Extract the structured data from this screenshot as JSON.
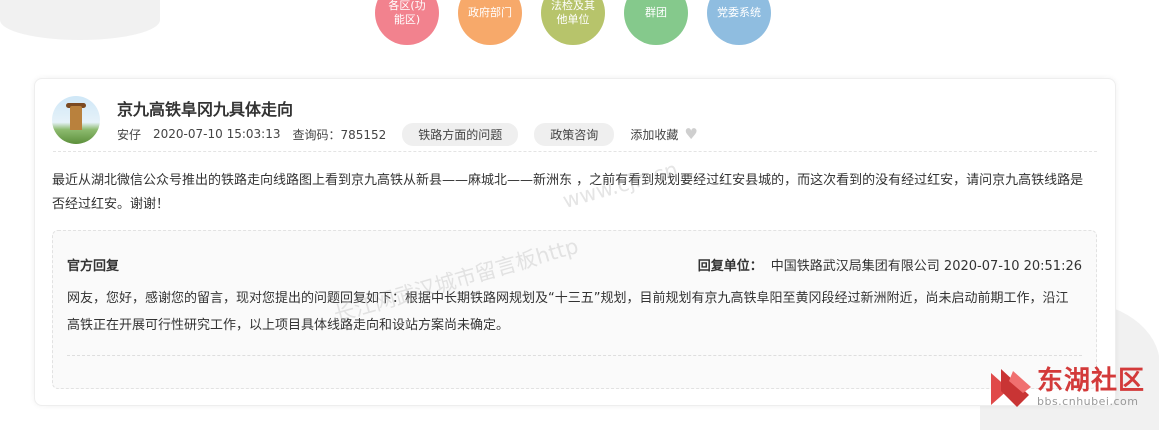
{
  "categories": [
    {
      "label": "各区(功能区)",
      "color": "#f2828e"
    },
    {
      "label": "政府部门",
      "color": "#f7a96a"
    },
    {
      "label": "法检及其他单位",
      "color": "#b7c46b"
    },
    {
      "label": "群团",
      "color": "#85c98c"
    },
    {
      "label": "党委系统",
      "color": "#8fbde0"
    }
  ],
  "post": {
    "title": "京九高铁阜冈九具体走向",
    "author": "安仔",
    "datetime": "2020-07-10 15:03:13",
    "query_code": "查询码：785152",
    "tags": [
      "铁路方面的问题",
      "政策咨询"
    ],
    "favorite_label": "添加收藏",
    "content": "最近从湖北微信公众号推出的铁路走向线路图上看到京九高铁从新县——麻城北——新洲东 ，之前有看到规划要经过红安县城的，而这次看到的没有经过红安，请问京九高铁线路是否经过红安。谢谢！"
  },
  "reply": {
    "label": "官方回复",
    "unit_label": "回复单位：",
    "unit_name": "中国铁路武汉局集团有限公司",
    "datetime": "2020-07-10 20:51:26",
    "content": "网友，您好，感谢您的留言，现对您提出的问题回复如下：根据中长期铁路网规划及“十三五”规划，目前规划有京九高铁阜阳至黄冈段经过新洲附近，尚未启动前期工作，沿江高铁正在开展可行性研究工作，以上项目具体线路走向和设站方案尚未确定。"
  },
  "watermark": {
    "line1": "www.cjn.cn",
    "line2": "长江网武汉城市留言板http"
  },
  "logo": {
    "main": "东湖社区",
    "sub": "bbs.cnhubei.com"
  }
}
